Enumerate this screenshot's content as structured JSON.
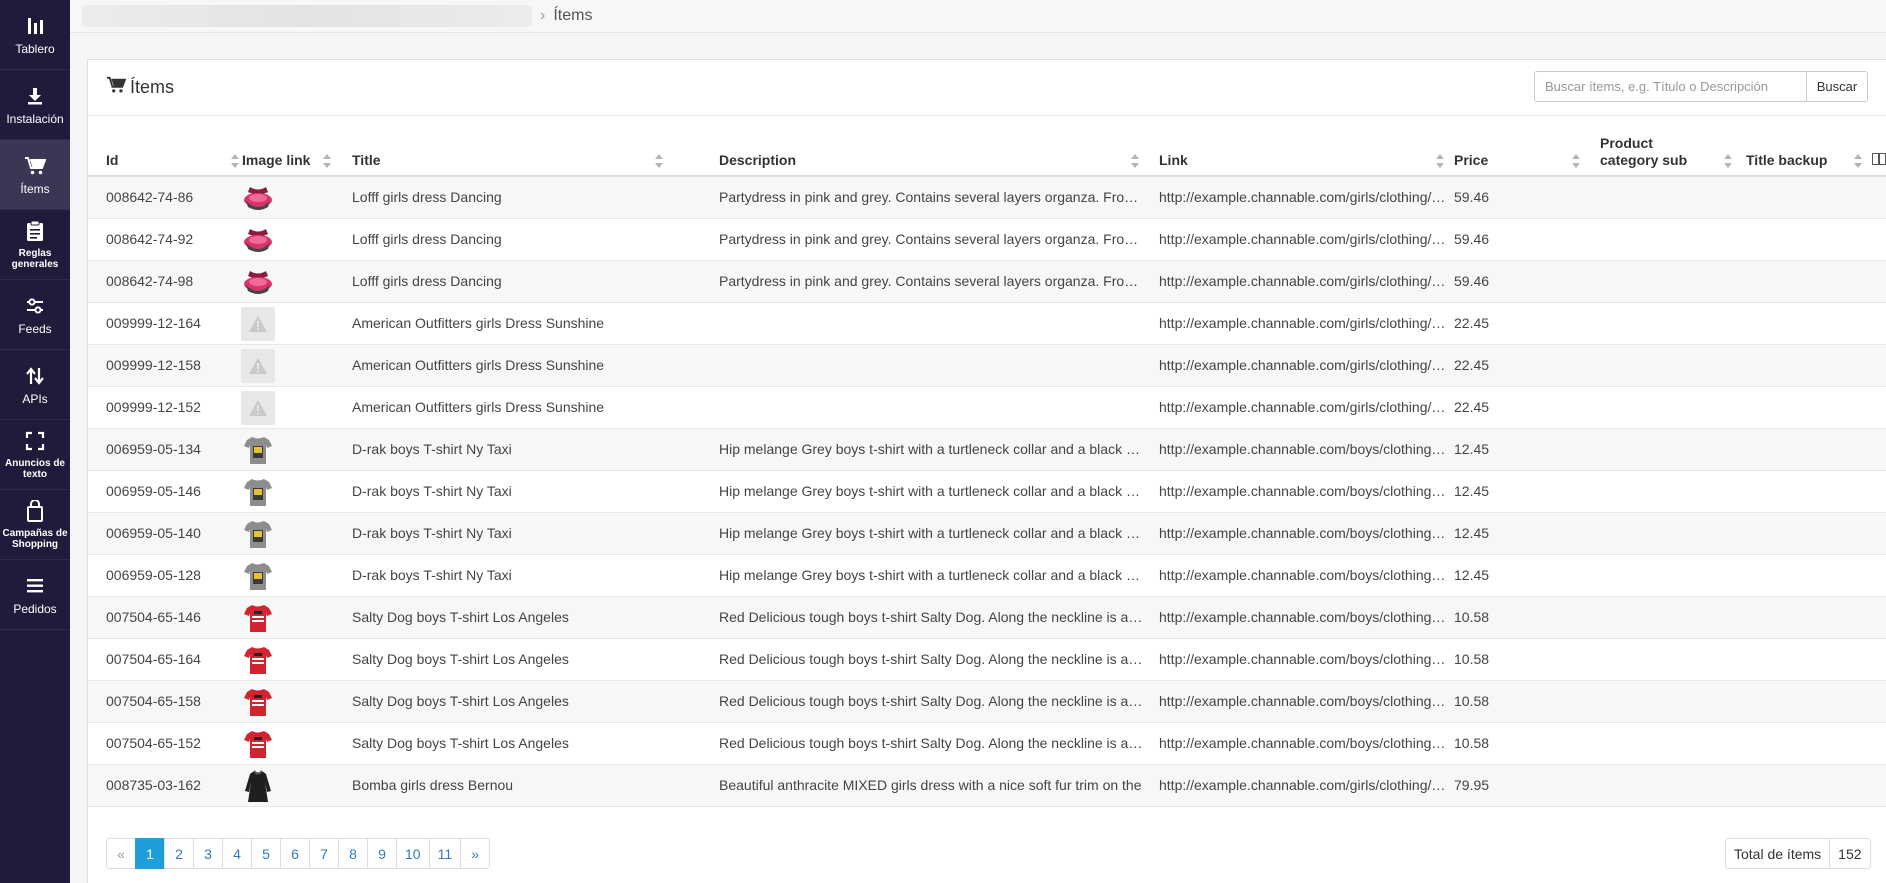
{
  "sidebar": {
    "items": [
      {
        "label": "Tablero",
        "icon": "dashboard-icon",
        "active": false
      },
      {
        "label": "Instalación",
        "icon": "download-icon",
        "active": false
      },
      {
        "label": "Ítems",
        "icon": "cart-icon",
        "active": true
      },
      {
        "label": "Reglas generales",
        "icon": "clipboard-icon",
        "active": false
      },
      {
        "label": "Feeds",
        "icon": "sliders-icon",
        "active": false
      },
      {
        "label": "APIs",
        "icon": "arrows-updown-icon",
        "active": false
      },
      {
        "label": "Anuncios de texto",
        "icon": "expand-icon",
        "active": false
      },
      {
        "label": "Campañas de Shopping",
        "icon": "shopping-bag-icon",
        "active": false
      },
      {
        "label": "Pedidos",
        "icon": "list-icon",
        "active": false
      }
    ]
  },
  "breadcrumb": {
    "current": "Ítems"
  },
  "panel": {
    "title": "Ítems"
  },
  "search": {
    "placeholder": "Buscar ítems, e.g. Título o Descripción",
    "button": "Buscar"
  },
  "table": {
    "columns": [
      "Id",
      "Image link",
      "Title",
      "Description",
      "Link",
      "Price",
      "Product category sub",
      "Title backup"
    ],
    "rows": [
      {
        "id": "008642-74-86",
        "image": "pink-dress",
        "title": "Lofff girls dress Dancing",
        "description": "Partydress in pink and grey. Contains several layers organza. From the",
        "link": "http://example.channable.com/girls/clothing/dresses",
        "price": "59.46"
      },
      {
        "id": "008642-74-92",
        "image": "pink-dress",
        "title": "Lofff girls dress Dancing",
        "description": "Partydress in pink and grey. Contains several layers organza. From the",
        "link": "http://example.channable.com/girls/clothing/dresses",
        "price": "59.46"
      },
      {
        "id": "008642-74-98",
        "image": "pink-dress",
        "title": "Lofff girls dress Dancing",
        "description": "Partydress in pink and grey. Contains several layers organza. From the",
        "link": "http://example.channable.com/girls/clothing/dresses",
        "price": "59.46"
      },
      {
        "id": "009999-12-164",
        "image": "not-available",
        "title": "American Outfitters girls Dress Sunshine",
        "description": "",
        "link": "http://example.channable.com/girls/clothing/dresses",
        "price": "22.45"
      },
      {
        "id": "009999-12-158",
        "image": "not-available",
        "title": "American Outfitters girls Dress Sunshine",
        "description": "",
        "link": "http://example.channable.com/girls/clothing/dresses",
        "price": "22.45"
      },
      {
        "id": "009999-12-152",
        "image": "not-available",
        "title": "American Outfitters girls Dress Sunshine",
        "description": "",
        "link": "http://example.channable.com/girls/clothing/dresses",
        "price": "22.45"
      },
      {
        "id": "006959-05-134",
        "image": "grey-tshirt",
        "title": "D-rak boys T-shirt Ny Taxi",
        "description": "Hip melange Grey boys t-shirt with a turtleneck collar and a black cord",
        "link": "http://example.channable.com/boys/clothing/t-shirts",
        "price": "12.45"
      },
      {
        "id": "006959-05-146",
        "image": "grey-tshirt",
        "title": "D-rak boys T-shirt Ny Taxi",
        "description": "Hip melange Grey boys t-shirt with a turtleneck collar and a black cord",
        "link": "http://example.channable.com/boys/clothing/t-shirts",
        "price": "12.45"
      },
      {
        "id": "006959-05-140",
        "image": "grey-tshirt",
        "title": "D-rak boys T-shirt Ny Taxi",
        "description": "Hip melange Grey boys t-shirt with a turtleneck collar and a black cord",
        "link": "http://example.channable.com/boys/clothing/t-shirts",
        "price": "12.45"
      },
      {
        "id": "006959-05-128",
        "image": "grey-tshirt",
        "title": "D-rak boys T-shirt Ny Taxi",
        "description": "Hip melange Grey boys t-shirt with a turtleneck collar and a black cord",
        "link": "http://example.channable.com/boys/clothing/t-shirts",
        "price": "12.45"
      },
      {
        "id": "007504-65-146",
        "image": "red-tshirt",
        "title": "Salty Dog boys T-shirt Los Angeles",
        "description": "Red Delicious tough boys t-shirt Salty Dog. Along the neckline is an elastic",
        "link": "http://example.channable.com/boys/clothing/t-shirts",
        "price": "10.58"
      },
      {
        "id": "007504-65-164",
        "image": "red-tshirt",
        "title": "Salty Dog boys T-shirt Los Angeles",
        "description": "Red Delicious tough boys t-shirt Salty Dog. Along the neckline is an elastic",
        "link": "http://example.channable.com/boys/clothing/t-shirts",
        "price": "10.58"
      },
      {
        "id": "007504-65-158",
        "image": "red-tshirt",
        "title": "Salty Dog boys T-shirt Los Angeles",
        "description": "Red Delicious tough boys t-shirt Salty Dog. Along the neckline is an elastic",
        "link": "http://example.channable.com/boys/clothing/t-shirts",
        "price": "10.58"
      },
      {
        "id": "007504-65-152",
        "image": "red-tshirt",
        "title": "Salty Dog boys T-shirt Los Angeles",
        "description": "Red Delicious tough boys t-shirt Salty Dog. Along the neckline is an elastic",
        "link": "http://example.channable.com/boys/clothing/t-shirts",
        "price": "10.58"
      },
      {
        "id": "008735-03-162",
        "image": "black-dress",
        "title": "Bomba girls dress Bernou",
        "description": "Beautiful anthracite MIXED girls dress with a nice soft fur trim on the",
        "link": "http://example.channable.com/girls/clothing/dresses",
        "price": "79.95"
      }
    ]
  },
  "pagination": {
    "prev": "«",
    "pages": [
      "1",
      "2",
      "3",
      "4",
      "5",
      "6",
      "7",
      "8",
      "9",
      "10",
      "11"
    ],
    "next": "»",
    "active": "1"
  },
  "total": {
    "label": "Total de ítems",
    "value": "152"
  },
  "colors": {
    "sidebar": "#1f1b3a",
    "sidebar_active": "#3a3654",
    "accent": "#1e9fd9",
    "link": "#337ab7"
  }
}
